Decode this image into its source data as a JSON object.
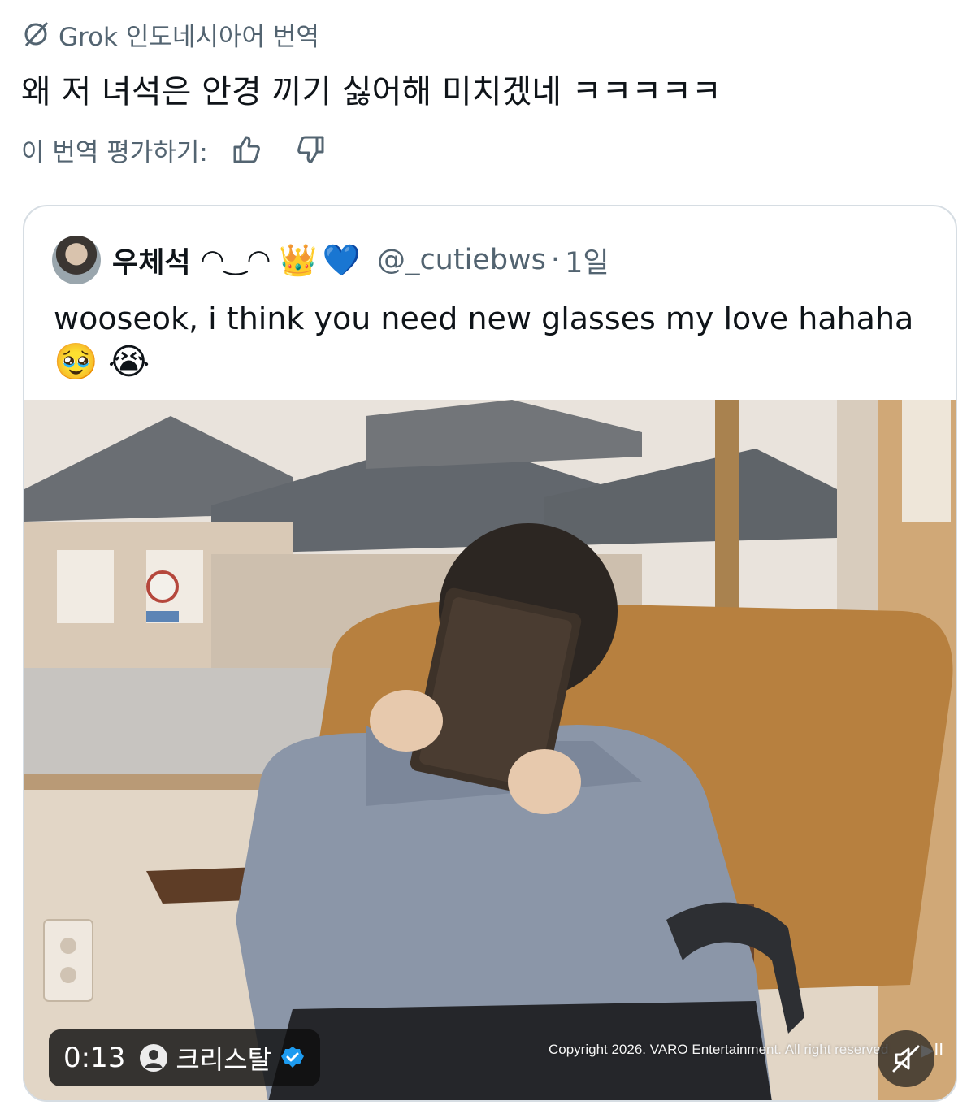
{
  "translation_header": {
    "label": "Grok 인도네시아어 번역",
    "icon": "grok-icon"
  },
  "translated_text": "왜 저 녀석은 안경 끼기 싫어해 미치겠네 ㅋㅋㅋㅋㅋ",
  "rating": {
    "label": "이 번역 평가하기:",
    "up_icon": "thumbs-up-icon",
    "down_icon": "thumbs-down-icon"
  },
  "quoted_post": {
    "display_name": "우체석",
    "name_decoration": "◠‿◠",
    "emojis": [
      "👑",
      "💙"
    ],
    "handle": "@_cutiebws",
    "separator": "·",
    "time": "1일",
    "text": "wooseok, i think you need new glasses my love hahaha",
    "text_emojis": [
      "🥹",
      "😭"
    ]
  },
  "video": {
    "timer": "0:13",
    "creator": "크리스탈",
    "copyright": "Copyright 2026. VARO Entertainment. All right reserved",
    "play_hint": "▶II",
    "mute_icon": "mute-icon",
    "colors": {
      "chair": "#b7803f",
      "sweater": "#8b96a8",
      "roof": "#676b70",
      "wall": "#d8ccbd"
    }
  }
}
